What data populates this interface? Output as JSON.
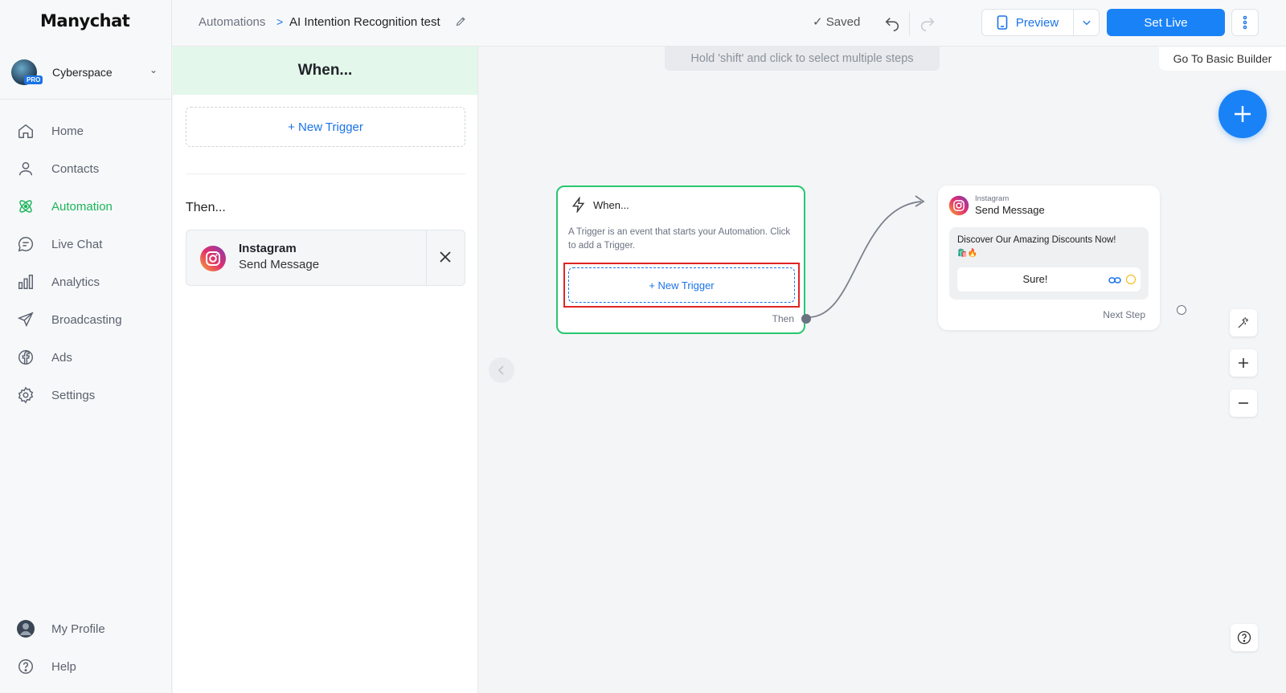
{
  "brand": {
    "logo_text": "Manychat"
  },
  "workspace": {
    "name": "Cyberspace",
    "badge": "PRO"
  },
  "sidebar": {
    "items": [
      {
        "label": "Home",
        "icon": "home-icon"
      },
      {
        "label": "Contacts",
        "icon": "user-icon"
      },
      {
        "label": "Automation",
        "icon": "atom-icon",
        "active": true
      },
      {
        "label": "Live Chat",
        "icon": "chat-icon"
      },
      {
        "label": "Analytics",
        "icon": "bar-chart-icon"
      },
      {
        "label": "Broadcasting",
        "icon": "send-icon"
      },
      {
        "label": "Ads",
        "icon": "facebook-icon"
      },
      {
        "label": "Settings",
        "icon": "gear-icon"
      }
    ],
    "bottom": [
      {
        "label": "My Profile",
        "icon": "avatar-icon"
      },
      {
        "label": "Help",
        "icon": "help-icon"
      }
    ]
  },
  "header": {
    "breadcrumb_root": "Automations",
    "breadcrumb_sep": ">",
    "title": "AI Intention Recognition test",
    "saved_label": "Saved",
    "preview_label": "Preview",
    "set_live_label": "Set Live"
  },
  "panel": {
    "title": "When...",
    "new_trigger_label": "+ New Trigger",
    "then_label": "Then...",
    "step": {
      "title": "Instagram",
      "subtitle": "Send Message"
    }
  },
  "canvas": {
    "hint": "Hold 'shift' and click to select multiple steps",
    "basic_builder_label": "Go To Basic Builder",
    "trigger_node": {
      "title": "When...",
      "description": "A Trigger is an event that starts your Automation. Click to add a Trigger.",
      "button_label": "+ New Trigger",
      "then_label": "Then"
    },
    "message_node": {
      "channel": "Instagram",
      "title": "Send Message",
      "text": "Discover Our Amazing Discounts Now!",
      "emoji": "🛍️🔥",
      "reply_label": "Sure!",
      "next_label": "Next Step"
    }
  },
  "colors": {
    "accent": "#1a82f7",
    "active_green": "#1bb55c",
    "trigger_border": "#28c76f",
    "highlight_red": "#e02424"
  }
}
